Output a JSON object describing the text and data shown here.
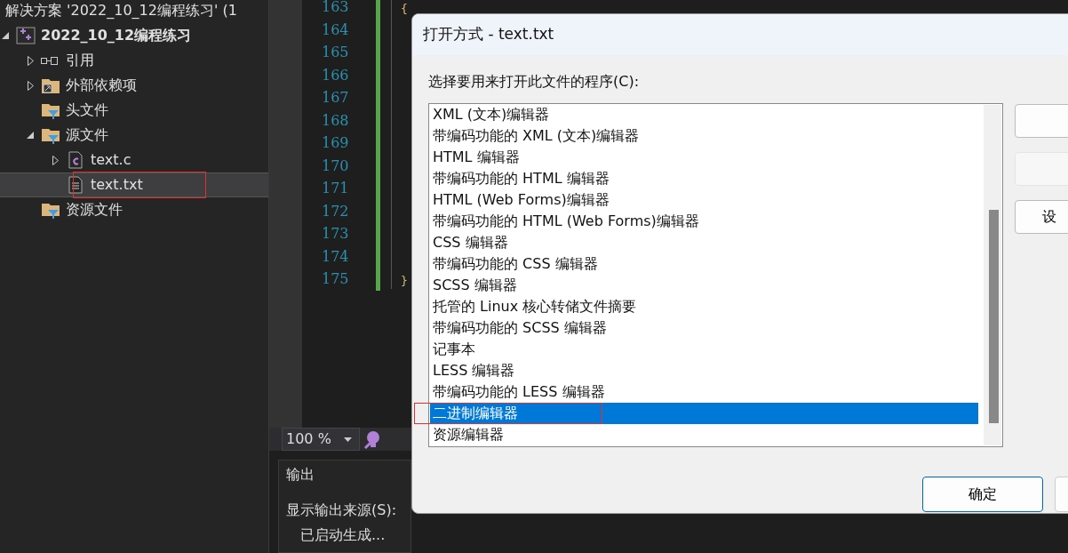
{
  "solution_title": "解决方案 '2022_10_12编程练习' (1",
  "tree": [
    {
      "label": "2022_10_12编程练习",
      "kind": "project",
      "expanded": true,
      "selected": false,
      "annotated": false,
      "children": [
        {
          "label": "引用",
          "kind": "references",
          "expanded": false,
          "selected": false,
          "annotated": false
        },
        {
          "label": "外部依赖项",
          "kind": "external",
          "expanded": false,
          "selected": false,
          "annotated": false
        },
        {
          "label": "头文件",
          "kind": "filter",
          "selected": false,
          "annotated": false
        },
        {
          "label": "源文件",
          "kind": "filter",
          "expanded": true,
          "selected": false,
          "annotated": false,
          "children": [
            {
              "label": "text.c",
              "kind": "cfile",
              "expanded": false,
              "selected": false,
              "annotated": false
            },
            {
              "label": "text.txt",
              "kind": "txtfile",
              "selected": true,
              "annotated": true
            }
          ]
        },
        {
          "label": "资源文件",
          "kind": "filter",
          "selected": false,
          "annotated": false
        }
      ]
    }
  ],
  "editor": {
    "line_numbers": [
      "163",
      "164",
      "165",
      "166",
      "167",
      "168",
      "169",
      "170",
      "171",
      "172",
      "173",
      "174",
      "175"
    ],
    "open_brace": "{",
    "close_brace": "}",
    "zoom": "100 %"
  },
  "output": {
    "title": "输出",
    "source_label": "显示输出来源(S):",
    "lines": [
      "已启动生成..."
    ]
  },
  "dialog": {
    "title": "打开方式 - text.txt",
    "prompt": "选择要用来打开此文件的程序(C):",
    "programs": [
      {
        "label": "XML (文本)编辑器",
        "selected": false,
        "annotated": false
      },
      {
        "label": "带编码功能的 XML (文本)编辑器",
        "selected": false,
        "annotated": false
      },
      {
        "label": "HTML 编辑器",
        "selected": false,
        "annotated": false
      },
      {
        "label": "带编码功能的 HTML 编辑器",
        "selected": false,
        "annotated": false
      },
      {
        "label": "HTML (Web Forms)编辑器",
        "selected": false,
        "annotated": false
      },
      {
        "label": "带编码功能的 HTML (Web Forms)编辑器",
        "selected": false,
        "annotated": false
      },
      {
        "label": "CSS 编辑器",
        "selected": false,
        "annotated": false
      },
      {
        "label": "带编码功能的 CSS 编辑器",
        "selected": false,
        "annotated": false
      },
      {
        "label": "SCSS 编辑器",
        "selected": false,
        "annotated": false
      },
      {
        "label": "托管的 Linux 核心转储文件摘要",
        "selected": false,
        "annotated": false
      },
      {
        "label": "带编码功能的 SCSS 编辑器",
        "selected": false,
        "annotated": false
      },
      {
        "label": "记事本",
        "selected": false,
        "annotated": false
      },
      {
        "label": "LESS 编辑器",
        "selected": false,
        "annotated": false
      },
      {
        "label": "带编码功能的 LESS 编辑器",
        "selected": false,
        "annotated": false
      },
      {
        "label": "二进制编辑器",
        "selected": true,
        "annotated": true
      },
      {
        "label": "资源编辑器",
        "selected": false,
        "annotated": false
      }
    ],
    "side_buttons": [
      {
        "disabled": false
      },
      {
        "disabled": true
      },
      {
        "label": "设",
        "disabled": false
      }
    ],
    "ok_button": "确定"
  }
}
